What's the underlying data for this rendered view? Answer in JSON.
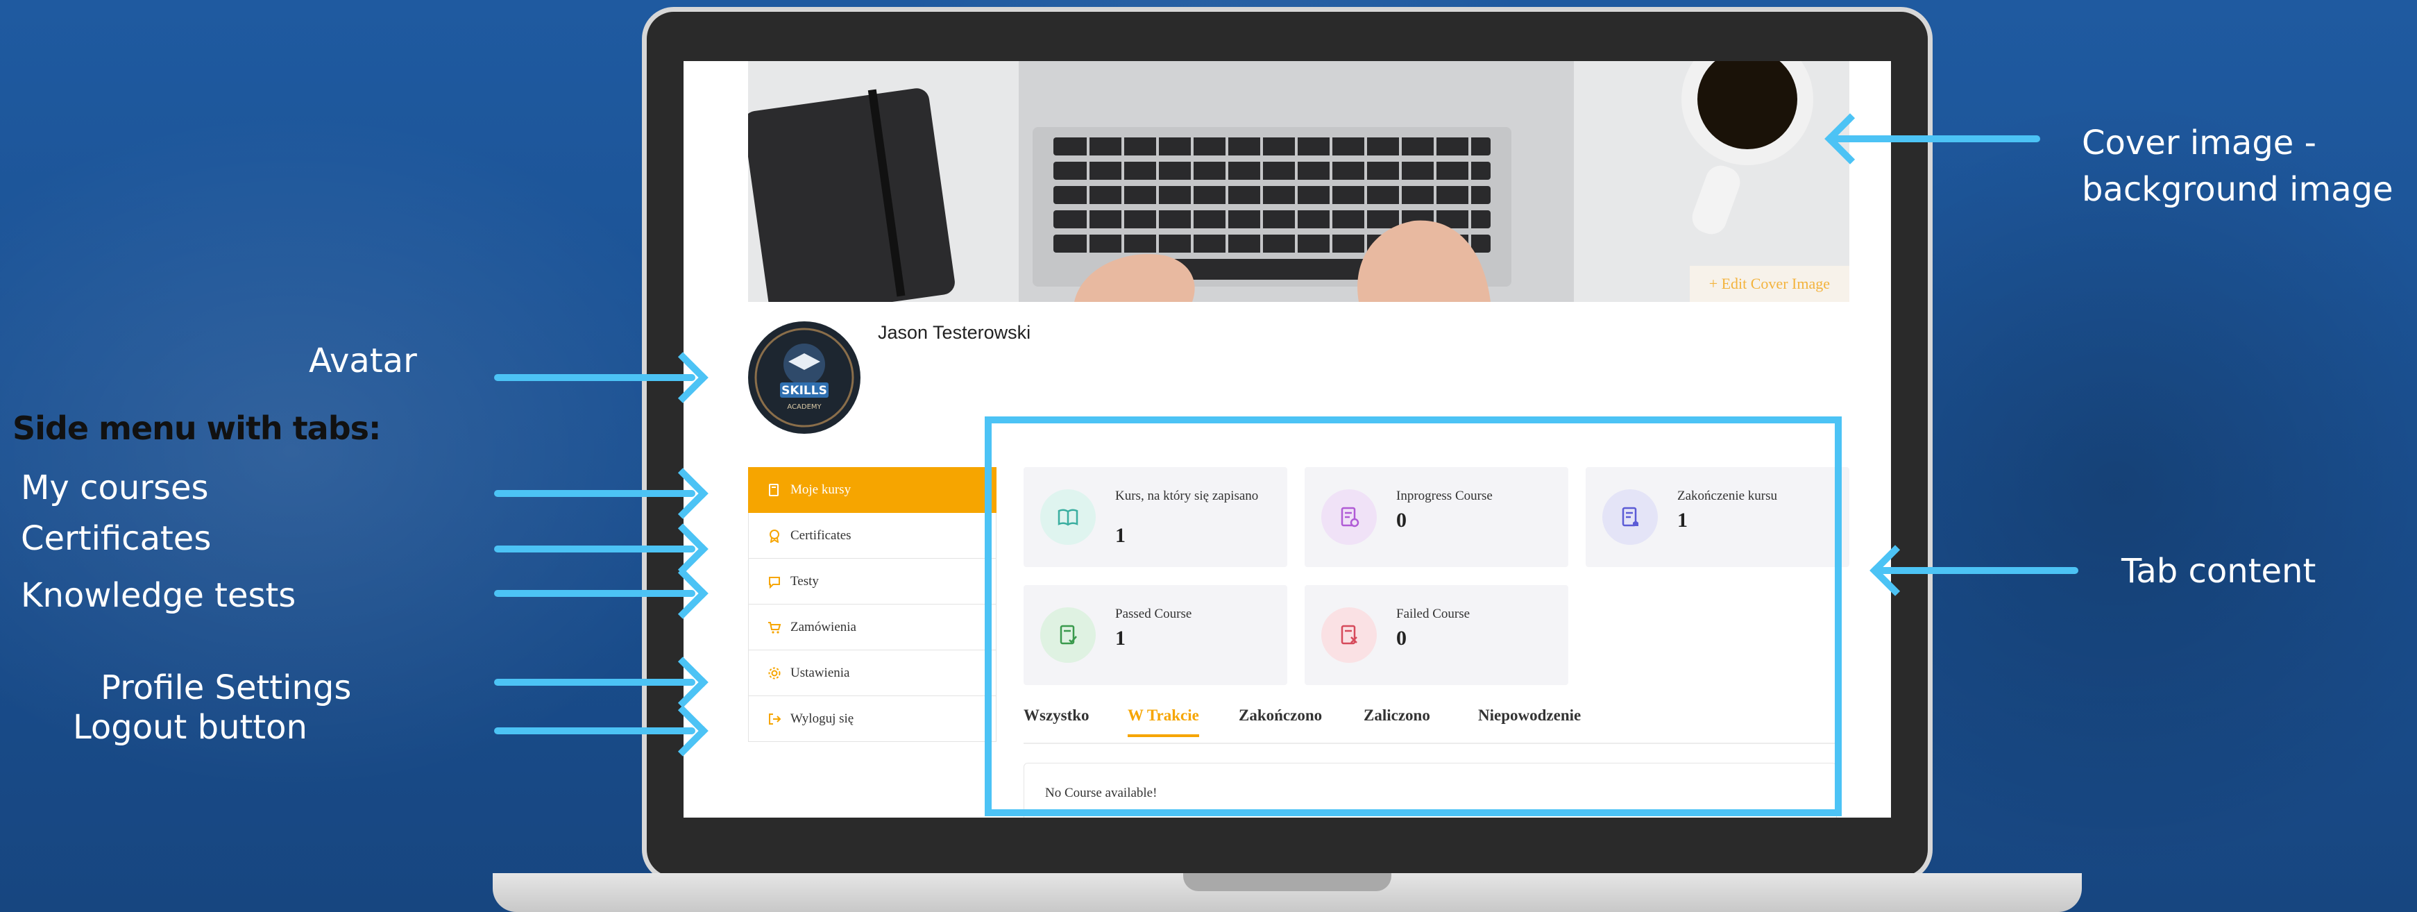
{
  "annotations": {
    "avatar": "Avatar",
    "side_menu_heading": "Side menu with tabs:",
    "my_courses": "My courses",
    "certificates": "Certificates",
    "knowledge_tests": "Knowledge tests",
    "profile_settings": "Profile Settings",
    "logout_button": "Logout button",
    "cover_image_line1": "Cover image -",
    "cover_image_line2": "background image",
    "tab_content": "Tab content"
  },
  "profile": {
    "edit_cover_label": "+ Edit Cover Image",
    "user_name": "Jason Testerowski",
    "avatar_text_1": "SKILLS",
    "avatar_text_2": "ACADEMY"
  },
  "side_menu": [
    {
      "label": "Moje kursy",
      "icon": "book-icon",
      "active": true
    },
    {
      "label": "Certificates",
      "icon": "certificate-icon"
    },
    {
      "label": "Testy",
      "icon": "chat-icon"
    },
    {
      "label": "Zamówienia",
      "icon": "cart-icon"
    },
    {
      "label": "Ustawienia",
      "icon": "gear-icon",
      "has_submenu": true
    },
    {
      "label": "Wyloguj się",
      "icon": "logout-icon"
    }
  ],
  "stats": [
    {
      "label": "Kurs, na który się zapisano",
      "value": "1",
      "icon": "book-open-icon",
      "color": "#3aaea0"
    },
    {
      "label": "Inprogress Course",
      "value": "0",
      "icon": "document-progress-icon",
      "color": "#b05bd6"
    },
    {
      "label": "Zakończenie kursu",
      "value": "1",
      "icon": "document-complete-icon",
      "color": "#5b5bd6"
    },
    {
      "label": "Passed Course",
      "value": "1",
      "icon": "document-check-icon",
      "color": "#3a9a4d"
    },
    {
      "label": "Failed Course",
      "value": "0",
      "icon": "document-x-icon",
      "color": "#d64a5b"
    }
  ],
  "tabs": [
    "Wszystko",
    "W Trakcie",
    "Zakończono",
    "Zaliczono",
    "Niepowodzenie"
  ],
  "active_tab": "W Trakcie",
  "empty_message": "No Course available!",
  "colors": {
    "accent": "#f6a500",
    "annotation_arrow": "#4cc3f5",
    "background": "#1f5aa0"
  }
}
